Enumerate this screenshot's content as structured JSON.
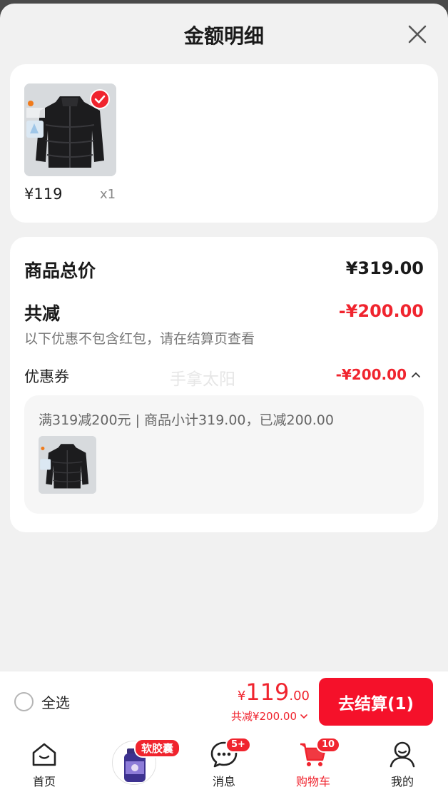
{
  "sheet": {
    "title": "金额明细"
  },
  "product": {
    "price": "¥119",
    "quantity": "x1",
    "image": "jacket-image"
  },
  "summary": {
    "total_label": "商品总价",
    "total_value": "¥319.00",
    "reduce_label": "共减",
    "reduce_value": "-¥200.00",
    "reduce_note": "以下优惠不包含红包，请在结算页查看"
  },
  "coupon": {
    "label": "优惠券",
    "watermark": "手拿太阳",
    "value": "-¥200.00",
    "rule_text": "满319减200元 | 商品小计319.00，已减200.00"
  },
  "checkout": {
    "select_all_label": "全选",
    "yen": "¥",
    "price_int": "119",
    "price_dec": ".00",
    "reduce_text": "共减¥200.00",
    "button_label": "去结算(1)"
  },
  "tabbar": {
    "home": "首页",
    "promo_badge": "软胶囊",
    "messages": "消息",
    "messages_badge": "5+",
    "cart": "购物车",
    "cart_badge": "10",
    "me": "我的"
  },
  "colors": {
    "accent": "#f0242e",
    "button": "#f5112a"
  }
}
